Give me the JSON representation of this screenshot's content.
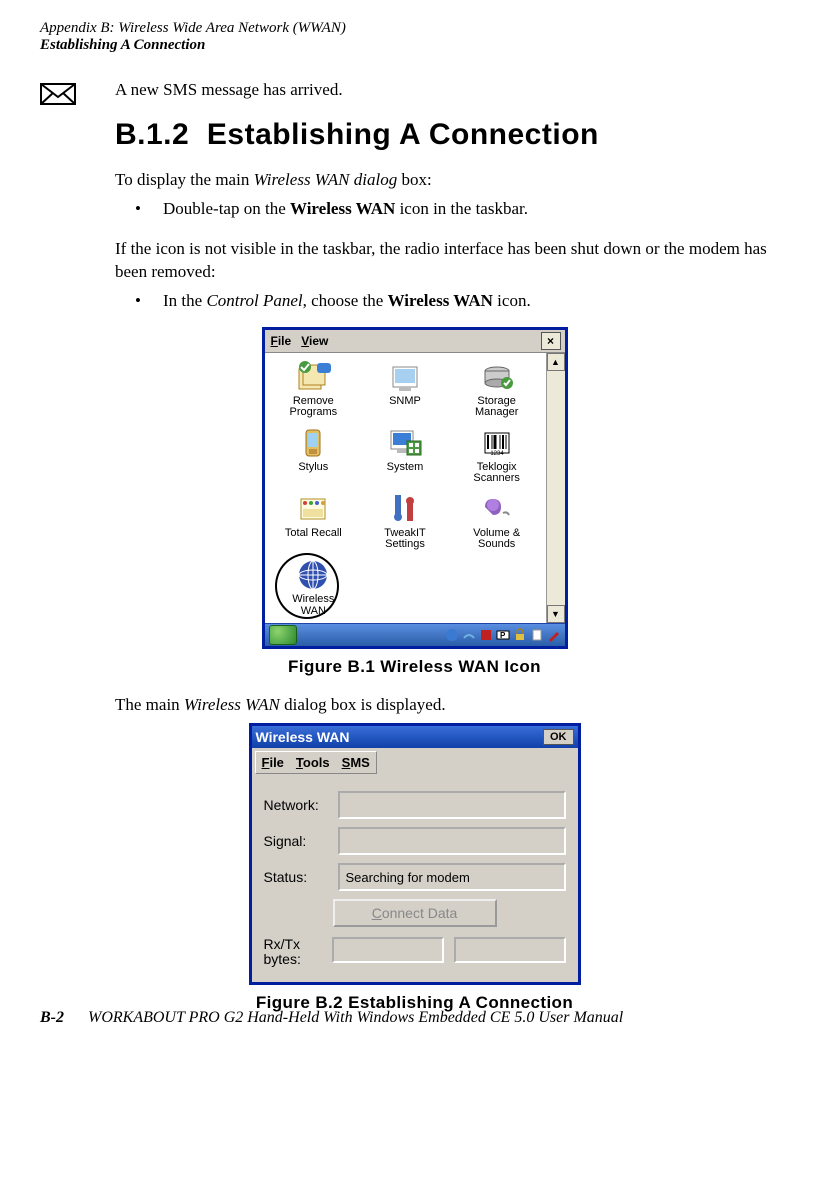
{
  "header": {
    "appendix": "Appendix B: Wireless Wide Area Network (WWAN)",
    "section": "Establishing A Connection"
  },
  "smsText": "A new SMS message has arrived.",
  "sectionNumber": "B.1.2",
  "sectionTitle": "Establishing A Connection",
  "para1_a": "To display the main ",
  "para1_italic": "Wireless WAN dialog",
  "para1_b": " box:",
  "bullet1_a": "Double-tap on the ",
  "bullet1_bold": "Wireless WAN",
  "bullet1_b": " icon in the taskbar.",
  "para2": "If the icon is not visible in the taskbar, the radio interface has been shut down or the modem has been removed:",
  "bullet2_a": "In the ",
  "bullet2_italic": "Control Panel",
  "bullet2_b": ", choose the ",
  "bullet2_bold": "Wireless WAN",
  "bullet2_c": " icon.",
  "para3_a": "The main ",
  "para3_italic": "Wireless WAN",
  "para3_b": " dialog box is displayed.",
  "figure1": "Figure B.1  Wireless WAN Icon",
  "figure2": "Figure B.2  Establishing A Connection",
  "footer": {
    "page": "B-2",
    "title": "WORKABOUT PRO G2 Hand-Held With Windows Embedded CE 5.0 User Manual"
  },
  "cp": {
    "menu_file": "File",
    "menu_view": "View",
    "items": {
      "remove": "Remove\nPrograms",
      "snmp": "SNMP",
      "storage": "Storage\nManager",
      "stylus": "Stylus",
      "system": "System",
      "teklogix": "Teklogix\nScanners",
      "totalrecall": "Total Recall",
      "tweakit": "TweakIT\nSettings",
      "volume": "Volume &\nSounds",
      "wwan": "Wireless\nWAN"
    }
  },
  "wwan": {
    "title": "Wireless WAN",
    "ok": "OK",
    "menu_file": "File",
    "menu_tools": "Tools",
    "menu_sms": "SMS",
    "lbl_network": "Network:",
    "lbl_signal": "Signal:",
    "lbl_status": "Status:",
    "val_status": "Searching for modem",
    "btn_connect": "Connect Data",
    "lbl_rxtx": "Rx/Tx\nbytes:"
  }
}
